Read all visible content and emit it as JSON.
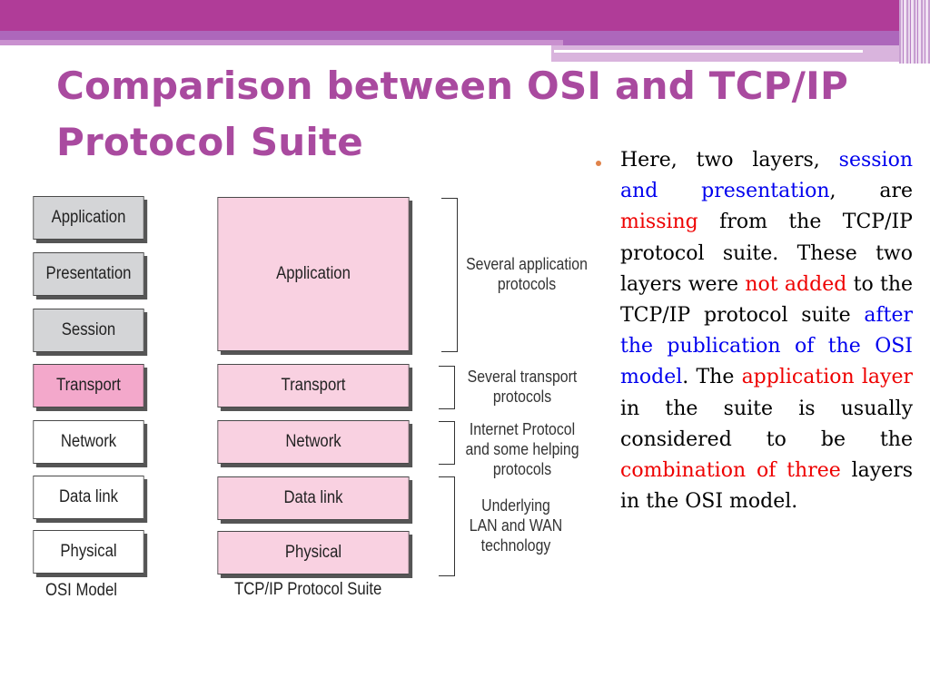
{
  "slide": {
    "title_line1": "Comparison between OSI and TCP/IP",
    "title_line2": "Protocol Suite",
    "colors": {
      "header_band": "#b03c98",
      "title": "#a94a9f",
      "highlight_blue": "#0000ee",
      "highlight_red": "#ee0000",
      "bullet": "#e0834a"
    }
  },
  "osi": {
    "caption": "OSI Model",
    "layers": [
      "Application",
      "Presentation",
      "Session",
      "Transport",
      "Network",
      "Data link",
      "Physical"
    ]
  },
  "tcpip": {
    "caption": "TCP/IP Protocol Suite",
    "layers": [
      "Application",
      "Transport",
      "Network",
      "Data link",
      "Physical"
    ]
  },
  "brackets": [
    {
      "line1": "Several application",
      "line2": "protocols"
    },
    {
      "line1": "Several transport",
      "line2": "protocols"
    },
    {
      "line1": "Internet Protocol",
      "line2": "and some helping",
      "line3": "protocols"
    },
    {
      "line1": "Underlying",
      "line2": "LAN and WAN",
      "line3": "technology"
    }
  ],
  "bullet": {
    "segments": [
      {
        "text": "Here, two layers, ",
        "style": "normal"
      },
      {
        "text": "session and presentation",
        "style": "blue"
      },
      {
        "text": ", are ",
        "style": "normal"
      },
      {
        "text": "missing",
        "style": "red"
      },
      {
        "text": " from the TCP/IP protocol suite. These two layers were ",
        "style": "normal"
      },
      {
        "text": "not added",
        "style": "red"
      },
      {
        "text": " to the TCP/IP protocol suite ",
        "style": "normal"
      },
      {
        "text": "after the publication of the OSI model",
        "style": "blue"
      },
      {
        "text": ". The ",
        "style": "normal"
      },
      {
        "text": "application layer",
        "style": "red"
      },
      {
        "text": " in the suite is usually considered to be the ",
        "style": "normal"
      },
      {
        "text": "combination of three",
        "style": "red"
      },
      {
        "text": " layers in the OSI model.",
        "style": "normal"
      }
    ]
  }
}
